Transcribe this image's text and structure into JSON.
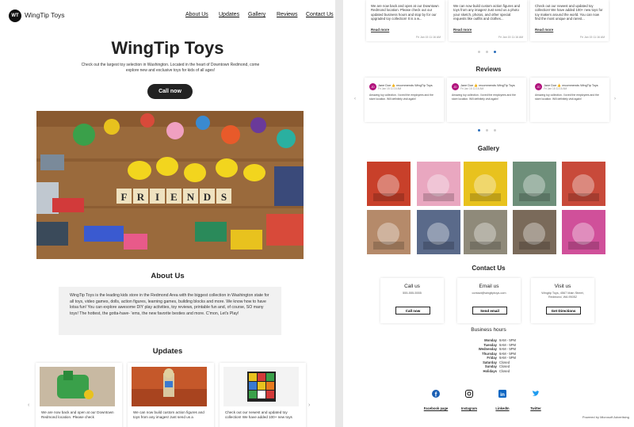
{
  "header": {
    "logo_text": "WT",
    "brand": "WingTip Toys",
    "nav": [
      "About Us",
      "Updates",
      "Gallery",
      "Reviews",
      "Contact Us"
    ]
  },
  "hero": {
    "title": "WingTip Toys",
    "subtitle": "Check out the largest toy selection in Washington. Located in the heart of Downtown Redmond, come explore new and exclusive toys for kids of all ages!",
    "cta": "Call now",
    "image_word": "FRIENDS"
  },
  "about": {
    "heading": "About Us",
    "body": "WingTip Toys is the leading kids store in the Redmond Area with the biggest collection in Washington state for all toys, video games, dolls, action figures, learning games, building blocks and more. We know how to have lotsa fun! You can explore awesome DIY play activities, toy reviews, printable fun and, of course, SO many toys! The hottest, the gotta-have- 'ems, the new favorite besties and more. C'mon, Let's Play!"
  },
  "updates": {
    "heading": "Updates",
    "cards": [
      {
        "text": "We are now back and open at our Downtown Redmond location. Please check"
      },
      {
        "text": "We can now build custom action figures and toys from any images! Just send us a"
      },
      {
        "text": "Check out our newest and updated toy collection! We have added 100+ new toys"
      }
    ]
  },
  "top_updates": [
    {
      "text": "We are now back and open at our Downtown Redmond location. Please check out our updated business hours and stop by for our upgraded toy collection! It is a w...",
      "link": "Read more",
      "date": "Fri Jan 15 11:16 AM"
    },
    {
      "text": "We can now build custom action figures and toys from any images! Just send us a photo your sketch, photos, and other special requests like outfits and clothes...",
      "link": "Read more",
      "date": "Fri Jan 15 11:16 AM"
    },
    {
      "text": "Check out our newest and updated toy collection! We have added 100+ new toys for toy makers around the world. You can now find the most unique and rarest...",
      "link": "Read more",
      "date": "Fri Jan 15 11:16 AM"
    }
  ],
  "reviews": {
    "heading": "Reviews",
    "items": [
      {
        "initials": "JD",
        "name": "Jane Doe 👍 recommends WingTip Toys",
        "date": "Fri Jan 15 11:16 AM",
        "text": "Amazing toy collection. I loved the employees and the store location. Will definitely visit again!"
      },
      {
        "initials": "JD",
        "name": "Jane Doe 👍 recommends WingTip Toys",
        "date": "Fri Jan 15 11:16 AM",
        "text": "Amazing toy collection. I loved the employees and the store location. Will definitely visit again!"
      },
      {
        "initials": "JD",
        "name": "Jane Doe 👍 recommends WingTip Toys",
        "date": "Fri Jan 15 11:16 AM",
        "text": "Amazing toy collection. I loved the employees and the store location. Will definitely visit again!"
      }
    ]
  },
  "gallery": {
    "heading": "Gallery",
    "colors": [
      "#c8402a",
      "#e9a7c0",
      "#e8c21e",
      "#6e8f7a",
      "#c84a3a",
      "#b58a6a",
      "#5a6a8a",
      "#8f8a7a",
      "#7a6a5a",
      "#d0509a"
    ]
  },
  "contact": {
    "heading": "Contact Us",
    "cards": [
      {
        "title": "Call us",
        "value": "555-555-5555",
        "button": "Call now"
      },
      {
        "title": "Email us",
        "value": "contact@wingtiptoys.com",
        "button": "Send email"
      },
      {
        "title": "Visit us",
        "value": "Wingtip Toys, 4567 Main Street, Redmond, WA 95052",
        "button": "Get Directions"
      }
    ]
  },
  "hours": {
    "title": "Business hours",
    "rows": [
      {
        "day": "Monday",
        "time": "9AM - 5PM"
      },
      {
        "day": "Tuesday",
        "time": "9AM - 5PM"
      },
      {
        "day": "Wednesday",
        "time": "9AM - 5PM"
      },
      {
        "day": "Thursday",
        "time": "9AM - 5PM"
      },
      {
        "day": "Friday",
        "time": "9AM - 5PM"
      },
      {
        "day": "Saturday",
        "time": "Closed"
      },
      {
        "day": "Sunday",
        "time": "Closed"
      },
      {
        "day": "Holidays",
        "time": "Closed"
      }
    ]
  },
  "social": [
    {
      "icon": "facebook-icon",
      "label": "Facebook page"
    },
    {
      "icon": "instagram-icon",
      "label": "Instagram"
    },
    {
      "icon": "linkedin-icon",
      "label": "LinkedIn"
    },
    {
      "icon": "twitter-icon",
      "label": "Twitter"
    }
  ],
  "footer": "Powered by Microsoft Advertising"
}
